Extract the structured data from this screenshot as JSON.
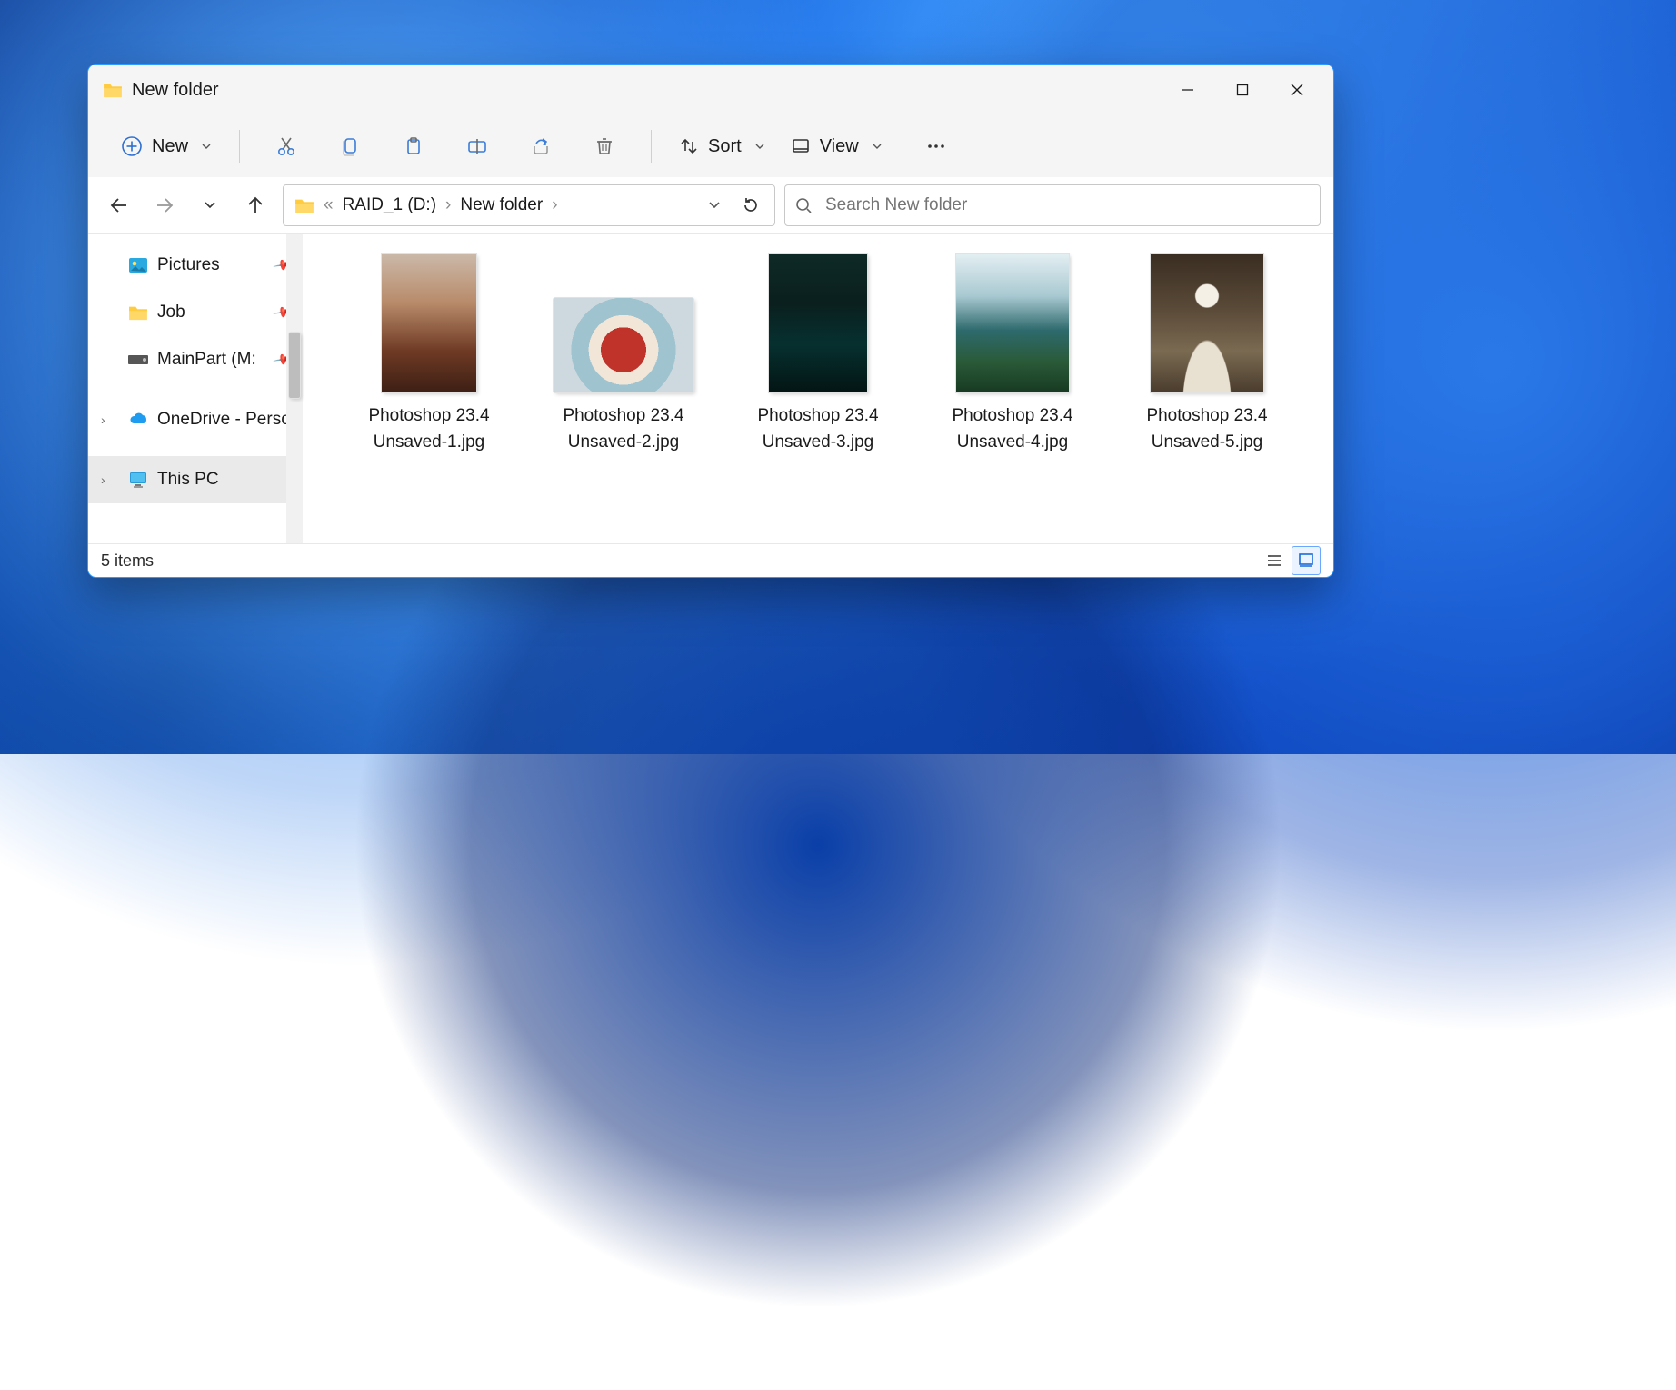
{
  "window": {
    "title": "New folder"
  },
  "toolbar": {
    "new_label": "New",
    "sort_label": "Sort",
    "view_label": "View"
  },
  "breadcrumb": {
    "segments": [
      "RAID_1 (D:)",
      "New folder"
    ]
  },
  "search": {
    "placeholder": "Search New folder"
  },
  "sidebar": {
    "items": [
      {
        "label": "Pictures",
        "type": "pictures",
        "pinned": true
      },
      {
        "label": "Job",
        "type": "folder",
        "pinned": true
      },
      {
        "label": "MainPart (M:",
        "type": "drive",
        "pinned": true
      },
      {
        "label": "OneDrive - Perso",
        "type": "onedrive",
        "expandable": true
      },
      {
        "label": "This PC",
        "type": "thispc",
        "expandable": true,
        "selected": true
      }
    ]
  },
  "files": [
    {
      "name": "Photoshop 23.4\nUnsaved-1.jpg"
    },
    {
      "name": "Photoshop 23.4\nUnsaved-2.jpg"
    },
    {
      "name": "Photoshop 23.4\nUnsaved-3.jpg"
    },
    {
      "name": "Photoshop 23.4\nUnsaved-4.jpg"
    },
    {
      "name": "Photoshop 23.4\nUnsaved-5.jpg"
    }
  ],
  "status": {
    "text": "5 items"
  }
}
